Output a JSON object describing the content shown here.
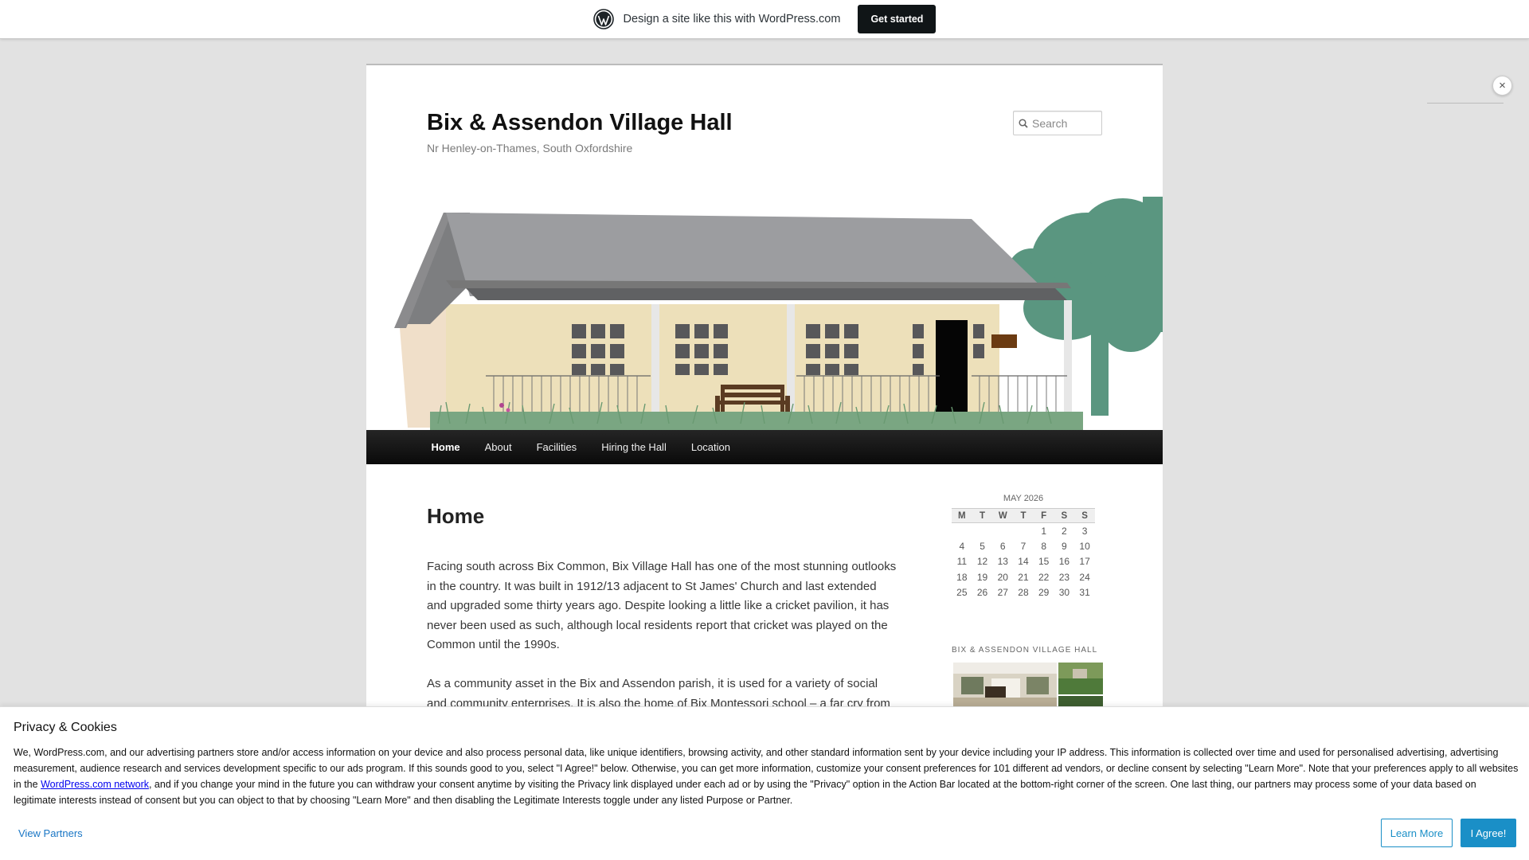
{
  "promo_bar": {
    "logo_icon": "wordpress-logo-icon",
    "text": "Design a site like this with WordPress.com",
    "cta": "Get started"
  },
  "site": {
    "title": "Bix & Assendon Village Hall",
    "description": "Nr Henley-on-Thames, South Oxfordshire",
    "search_placeholder": "Search"
  },
  "nav": {
    "items": [
      {
        "label": "Home",
        "active": true
      },
      {
        "label": "About"
      },
      {
        "label": "Facilities"
      },
      {
        "label": "Hiring the Hall"
      },
      {
        "label": "Location"
      }
    ]
  },
  "entry": {
    "title": "Home",
    "paragraphs": [
      "Facing south across Bix Common, Bix Village Hall has one of the most stunning outlooks in the country. It was built in 1912/13 adjacent to St James' Church and last extended and upgraded some thirty years ago. Despite looking a little like a cricket pavilion, it has never been used as such, although local residents report that cricket was played on the Common until the 1990s.",
      "As a community asset in the Bix and Assendon parish, it is used for a variety of social and community enterprises. It is also the home of Bix Montessori school – a far cry from"
    ]
  },
  "calendar": {
    "caption": "MAY 2026",
    "days": [
      "M",
      "T",
      "W",
      "T",
      "F",
      "S",
      "S"
    ],
    "weeks": [
      [
        "",
        "",
        "",
        "",
        "1",
        "2",
        "3"
      ],
      [
        "4",
        "5",
        "6",
        "7",
        "8",
        "9",
        "10"
      ],
      [
        "11",
        "12",
        "13",
        "14",
        "15",
        "16",
        "17"
      ],
      [
        "18",
        "19",
        "20",
        "21",
        "22",
        "23",
        "24"
      ],
      [
        "25",
        "26",
        "27",
        "28",
        "29",
        "30",
        "31"
      ]
    ]
  },
  "gallery_widget": {
    "title": "BIX & ASSENDON VILLAGE HALL"
  },
  "consent": {
    "title": "Privacy & Cookies",
    "text_before_link": "We, WordPress.com, and our advertising partners store and/or access information on your device and also process personal data, like unique identifiers, browsing activity, and other standard information sent by your device including your IP address. This information is collected over time and used for personalised advertising, advertising measurement, audience research and services development specific to our ads program. If this sounds good to you, select \"I Agree!\" below. Otherwise, you can get more information, customize your consent preferences for 101 different ad vendors, or decline consent by selecting \"Learn More\". Note that your preferences apply to all websites in the ",
    "link_text": "WordPress.com network",
    "text_after_link": ", and if you change your mind in the future you can withdraw your consent anytime by visiting the Privacy link displayed under each ad or by using the \"Privacy\" option in the Action Bar located at the bottom-right corner of the screen. One last thing, our partners may process some of your data based on legitimate interests instead of consent but you can object to that by choosing \"Learn More\" and then disabling the Legitimate Interests toggle under any listed Purpose or Partner.",
    "view_partners": "View Partners",
    "learn_more": "Learn More",
    "agree": "I Agree!"
  },
  "close_label": "×"
}
